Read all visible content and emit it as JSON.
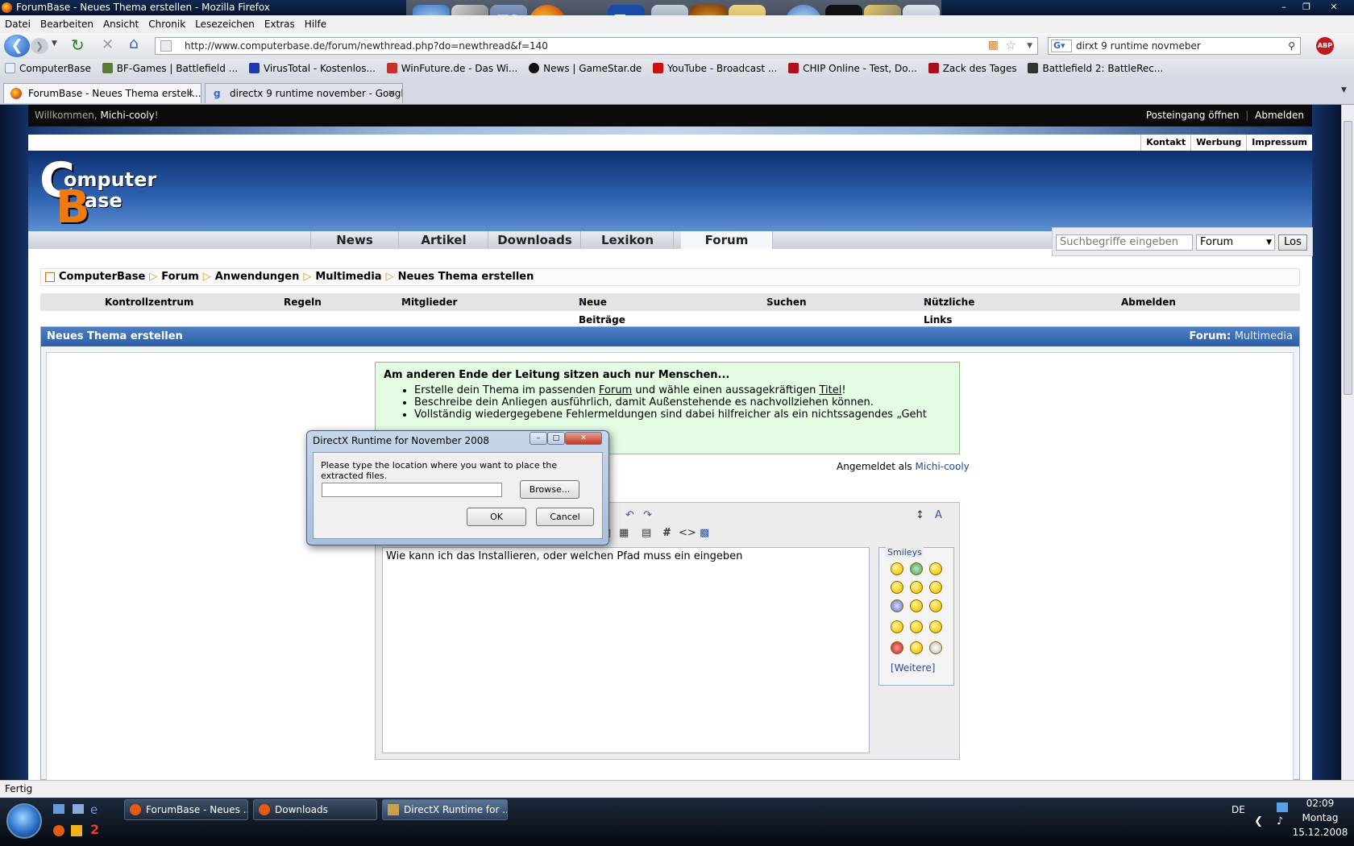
{
  "window": {
    "title": "ForumBase - Neues Thema erstellen - Mozilla Firefox"
  },
  "menu": [
    "Datei",
    "Bearbeiten",
    "Ansicht",
    "Chronik",
    "Lesezeichen",
    "Extras",
    "Hilfe"
  ],
  "navbar": {
    "url": "http://www.computerbase.de/forum/newthread.php?do=newthread&f=140",
    "search_value": "dirxt 9 runtime novmeber"
  },
  "bookmarks": [
    "ComputerBase",
    "BF-Games | Battlefield ...",
    "VirusTotal - Kostenlos...",
    "WinFuture.de - Das Wi...",
    "News | GameStar.de",
    "YouTube - Broadcast ...",
    "CHIP Online - Test, Do...",
    "Zack des Tages",
    "Battlefield 2: BattleRec..."
  ],
  "tabs": [
    {
      "label": "ForumBase - Neues Thema erstell..."
    },
    {
      "label": "directx 9 runtime november - Googl..."
    }
  ],
  "page": {
    "welcome_prefix": "Willkommen,",
    "welcome_name": "Michi-cooly",
    "welcome_suffix": "!",
    "top_actions": [
      "Posteingang öffnen",
      "Abmelden"
    ],
    "top_links": [
      "Kontakt",
      "Werbung",
      "Impressum"
    ],
    "logo": {
      "line1": "omputer",
      "line2": "ase",
      "c": "C",
      "b": "B"
    },
    "nav_tabs": [
      "News",
      "Artikel",
      "Downloads",
      "Lexikon",
      "Forum"
    ],
    "site_search": {
      "placeholder": "Suchbegriffe eingeben",
      "select": "Forum",
      "button": "Los"
    },
    "breadcrumbs": [
      "ComputerBase",
      "Forum",
      "Anwendungen",
      "Multimedia",
      "Neues Thema erstellen"
    ],
    "user_nav": [
      "Kontrollzentrum",
      "Regeln",
      "Mitglieder",
      "Neue Beiträge",
      "Suchen",
      "Nützliche Links",
      "Abmelden"
    ],
    "panel_title": "Neues Thema erstellen",
    "panel_forum_label": "Forum:",
    "panel_forum": "Multimedia",
    "hint": {
      "heading": "Am anderen Ende der Leitung sitzen auch nur Menschen...",
      "b1_a": "Erstelle dein Thema im passenden ",
      "b1_link1": "Forum",
      "b1_b": " und wähle einen aussagekräftigen ",
      "b1_link2": "Titel",
      "b1_c": "!",
      "b2": "Beschreibe dein Anliegen ausführlich, damit Außenstehende es nachvollziehen können.",
      "b3": "Vollständig wiedergegebene Fehlermeldungen sind dabei hilfreicher als ein nichtssagendes „Geht"
    },
    "logged_in_label": "Angemeldet als",
    "logged_in_user": "Michi-cooly",
    "message_text": "Wie kann ich das Installieren, oder welchen Pfad muss ein eingeben",
    "smileys_title": "Smileys",
    "smileys_more": "[Weitere]"
  },
  "dialog": {
    "title": "DirectX Runtime for November 2008",
    "message": "Please type the location where you want to place the extracted files.",
    "path_value": "",
    "browse": "Browse...",
    "ok": "OK",
    "cancel": "Cancel"
  },
  "status": "Fertig",
  "taskbar": {
    "items": [
      "ForumBase - Neues ...",
      "Downloads",
      "DirectX Runtime for ..."
    ],
    "lang": "DE",
    "time": "02:09",
    "day": "Montag",
    "date": "15.12.2008"
  }
}
